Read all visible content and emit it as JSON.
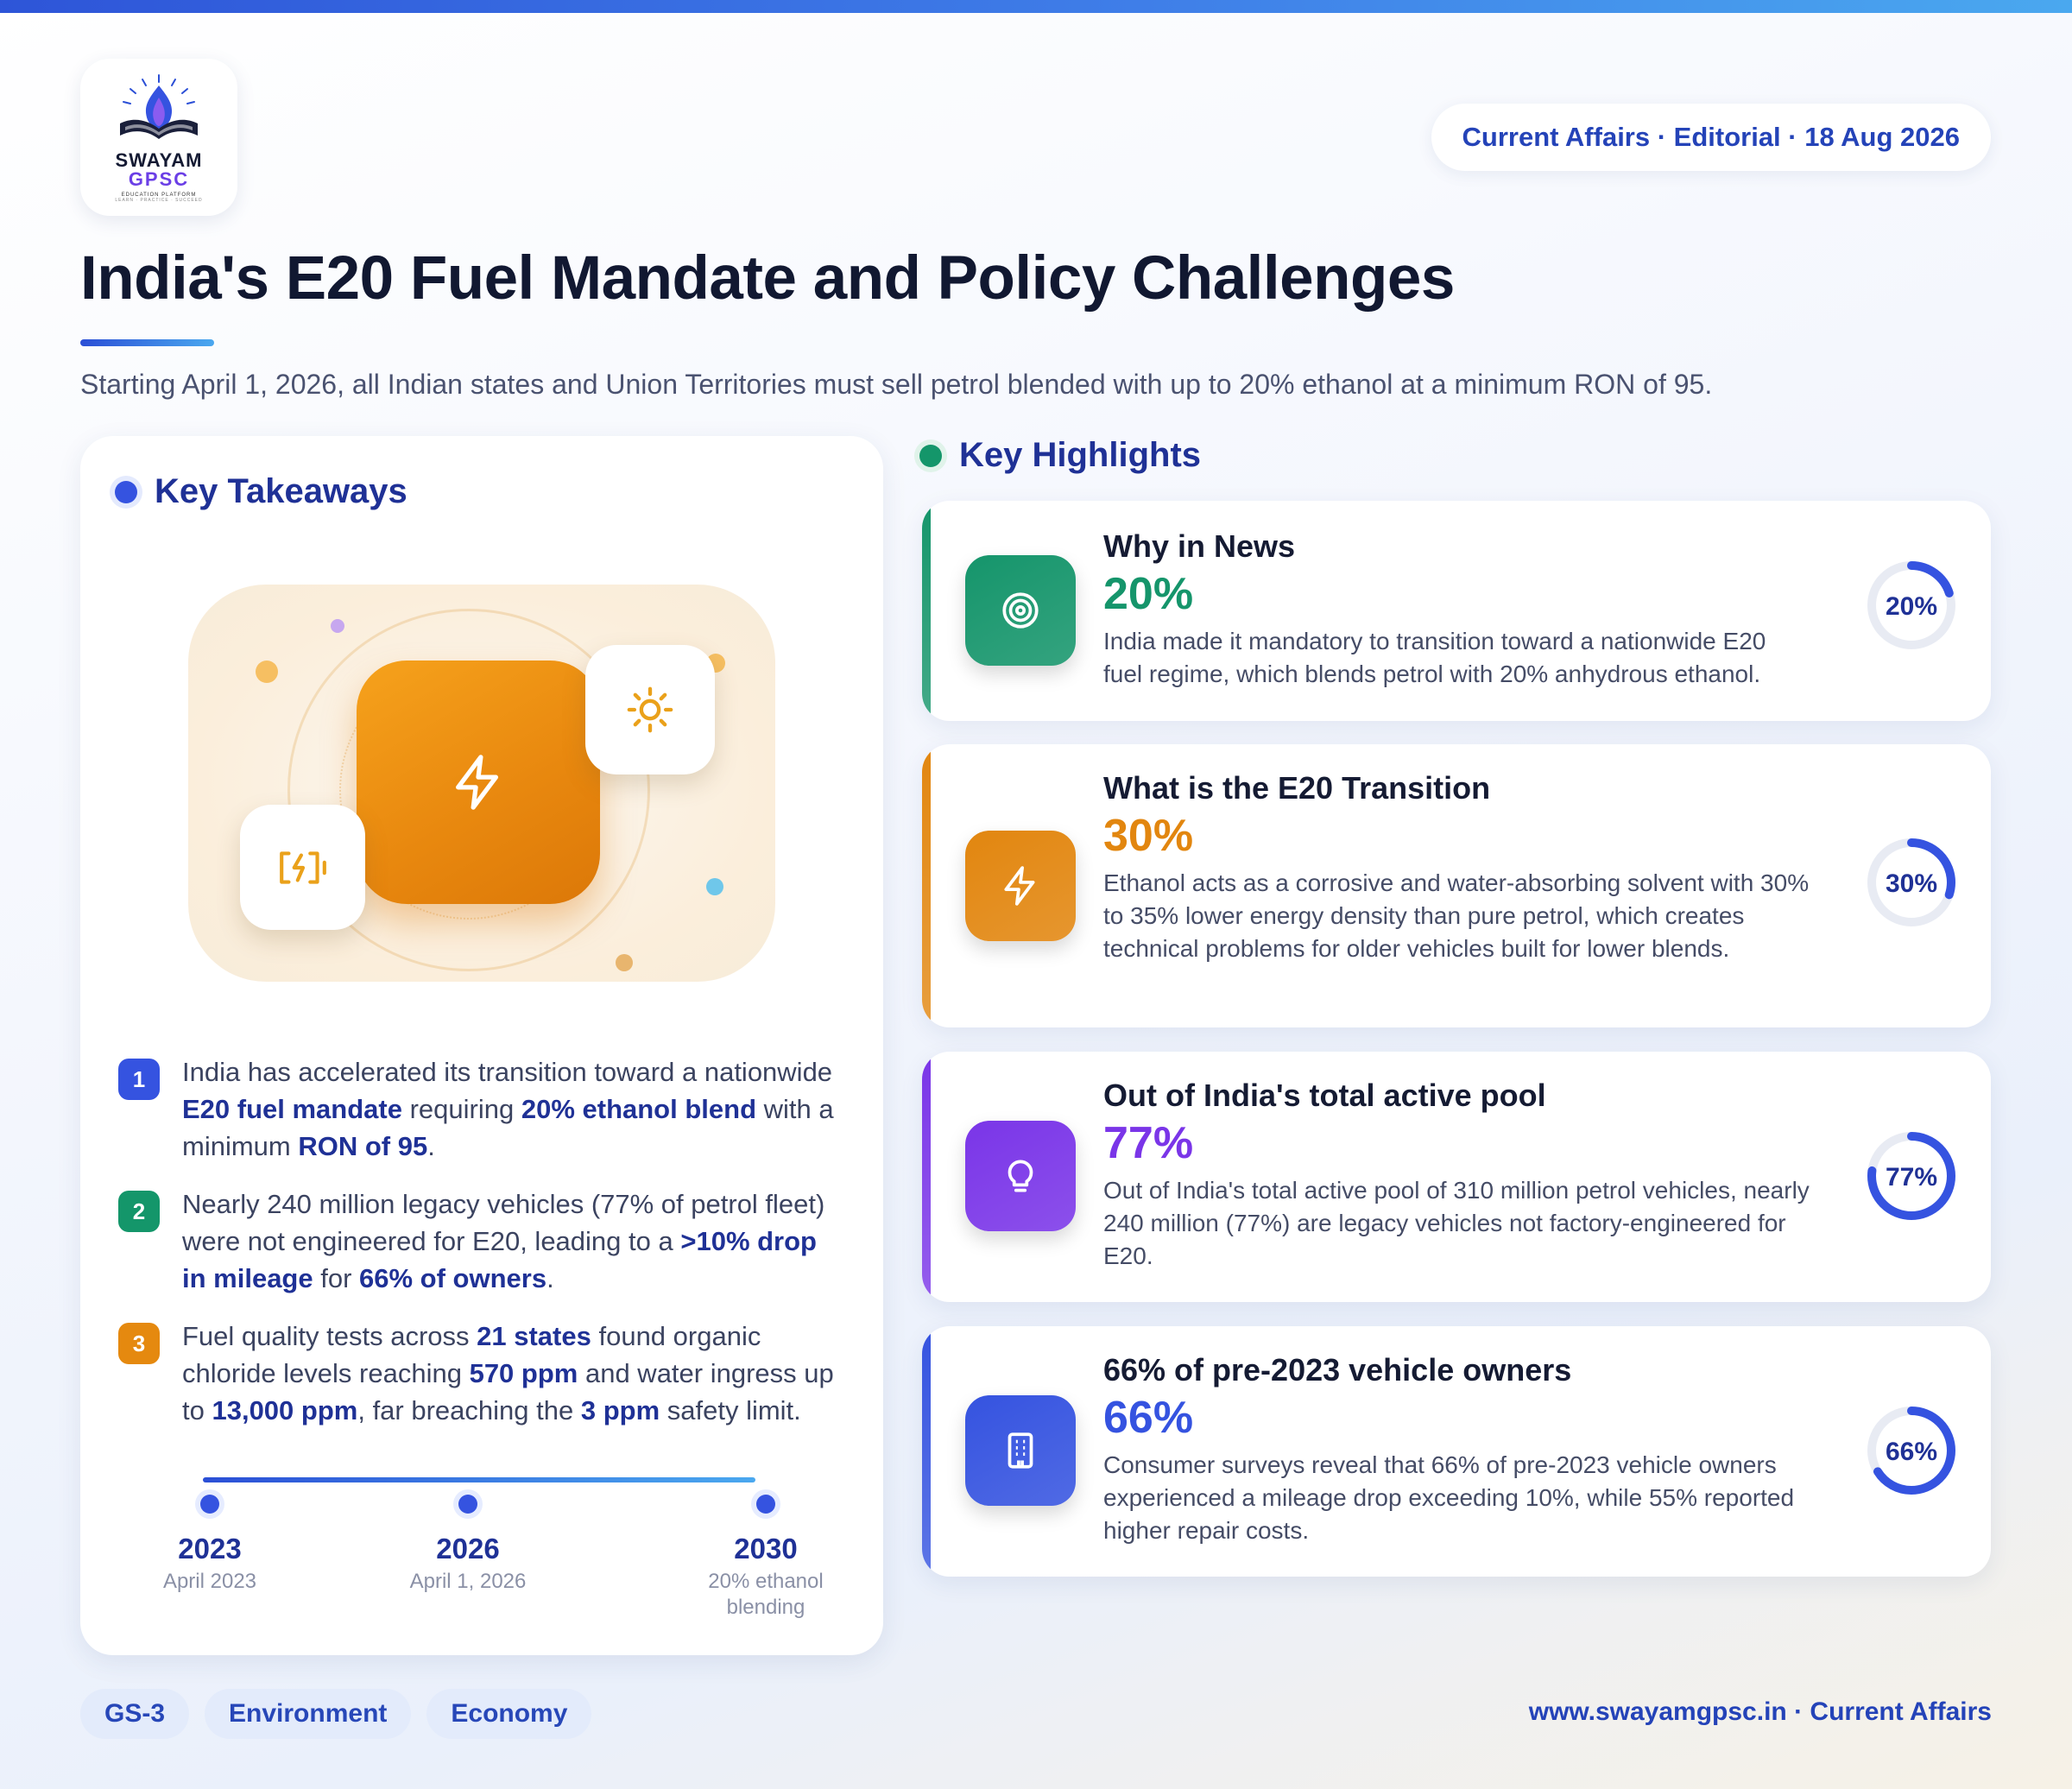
{
  "brand": {
    "name_line1": "SWAYAM",
    "name_line2": "GPSC",
    "tagline": "EDUCATION PLATFORM",
    "motto": "LEARN · PRACTICE · SUCCEED"
  },
  "header": {
    "date_pill": "Current Affairs · Editorial · 18 Aug 2026",
    "title": "India's E20 Fuel Mandate and Policy Challenges",
    "subtitle": "Starting April 1, 2026, all Indian states and Union Territories must sell petrol blended with up to 20% ethanol at a minimum RON of 95."
  },
  "key_takeaways": {
    "heading": "Key Takeaways",
    "items": [
      {
        "num": "1",
        "color": "#3553e0",
        "parts": [
          {
            "t": "India has accelerated its transition toward a nationwide "
          },
          {
            "t": "E20 fuel mandate",
            "b": true
          },
          {
            "t": " requiring "
          },
          {
            "t": "20% ethanol blend",
            "b": true
          },
          {
            "t": " with a minimum "
          },
          {
            "t": "RON of 95",
            "b": true
          },
          {
            "t": "."
          }
        ]
      },
      {
        "num": "2",
        "color": "#14966a",
        "parts": [
          {
            "t": "Nearly 240 million legacy vehicles (77% of petrol fleet) were not engineered for E20, leading to a "
          },
          {
            "t": ">10% drop in mileage",
            "b": true
          },
          {
            "t": " for "
          },
          {
            "t": "66% of owners",
            "b": true
          },
          {
            "t": "."
          }
        ]
      },
      {
        "num": "3",
        "color": "#e5890f",
        "parts": [
          {
            "t": "Fuel quality tests across "
          },
          {
            "t": "21 states",
            "b": true
          },
          {
            "t": " found organic chloride levels reaching "
          },
          {
            "t": "570 ppm",
            "b": true
          },
          {
            "t": " and water ingress up to "
          },
          {
            "t": "13,000 ppm",
            "b": true
          },
          {
            "t": ", far breaching the "
          },
          {
            "t": "3 ppm",
            "b": true
          },
          {
            "t": " safety limit."
          }
        ]
      }
    ],
    "timeline": [
      {
        "year": "2023",
        "caption": "April 2023"
      },
      {
        "year": "2026",
        "caption": "April 1, 2026"
      },
      {
        "year": "2030",
        "caption": "20% ethanol blending"
      }
    ]
  },
  "key_highlights": {
    "heading": "Key Highlights",
    "cards": [
      {
        "title": "Why in News",
        "percent_label": "20%",
        "percent_value": 20,
        "color": "#15956b",
        "icon": "target-icon",
        "description": "India made it mandatory to transition toward a nationwide E20 fuel regime, which blends petrol with 20% anhydrous ethanol."
      },
      {
        "title": "What is the E20 Transition",
        "percent_label": "30%",
        "percent_value": 30,
        "color": "#e2860f",
        "icon": "lightning-icon",
        "description": "Ethanol acts as a corrosive and water-absorbing solvent with 30% to 35% lower energy density than pure petrol, which creates technical problems for older vehicles built for lower blends."
      },
      {
        "title": "Out of India's total active pool",
        "percent_label": "77%",
        "percent_value": 77,
        "color": "#7a35e8",
        "icon": "lightbulb-icon",
        "description": "Out of India's total active pool of 310 million petrol vehicles, nearly 240 million (77%) are legacy vehicles not factory-engineered for E20."
      },
      {
        "title": "66% of pre-2023 vehicle owners",
        "percent_label": "66%",
        "percent_value": 66,
        "color": "#3553e0",
        "icon": "building-icon",
        "description": "Consumer surveys reveal that 66% of pre-2023 vehicle owners experienced a mileage drop exceeding 10%, while 55% reported higher repair costs."
      }
    ]
  },
  "footer": {
    "tags": [
      "GS-3",
      "Environment",
      "Economy"
    ],
    "link": "www.swayamgpsc.in · Current Affairs"
  },
  "colors": {
    "accent": "#3553e0",
    "title": "#111831",
    "heading": "#1f3196"
  }
}
